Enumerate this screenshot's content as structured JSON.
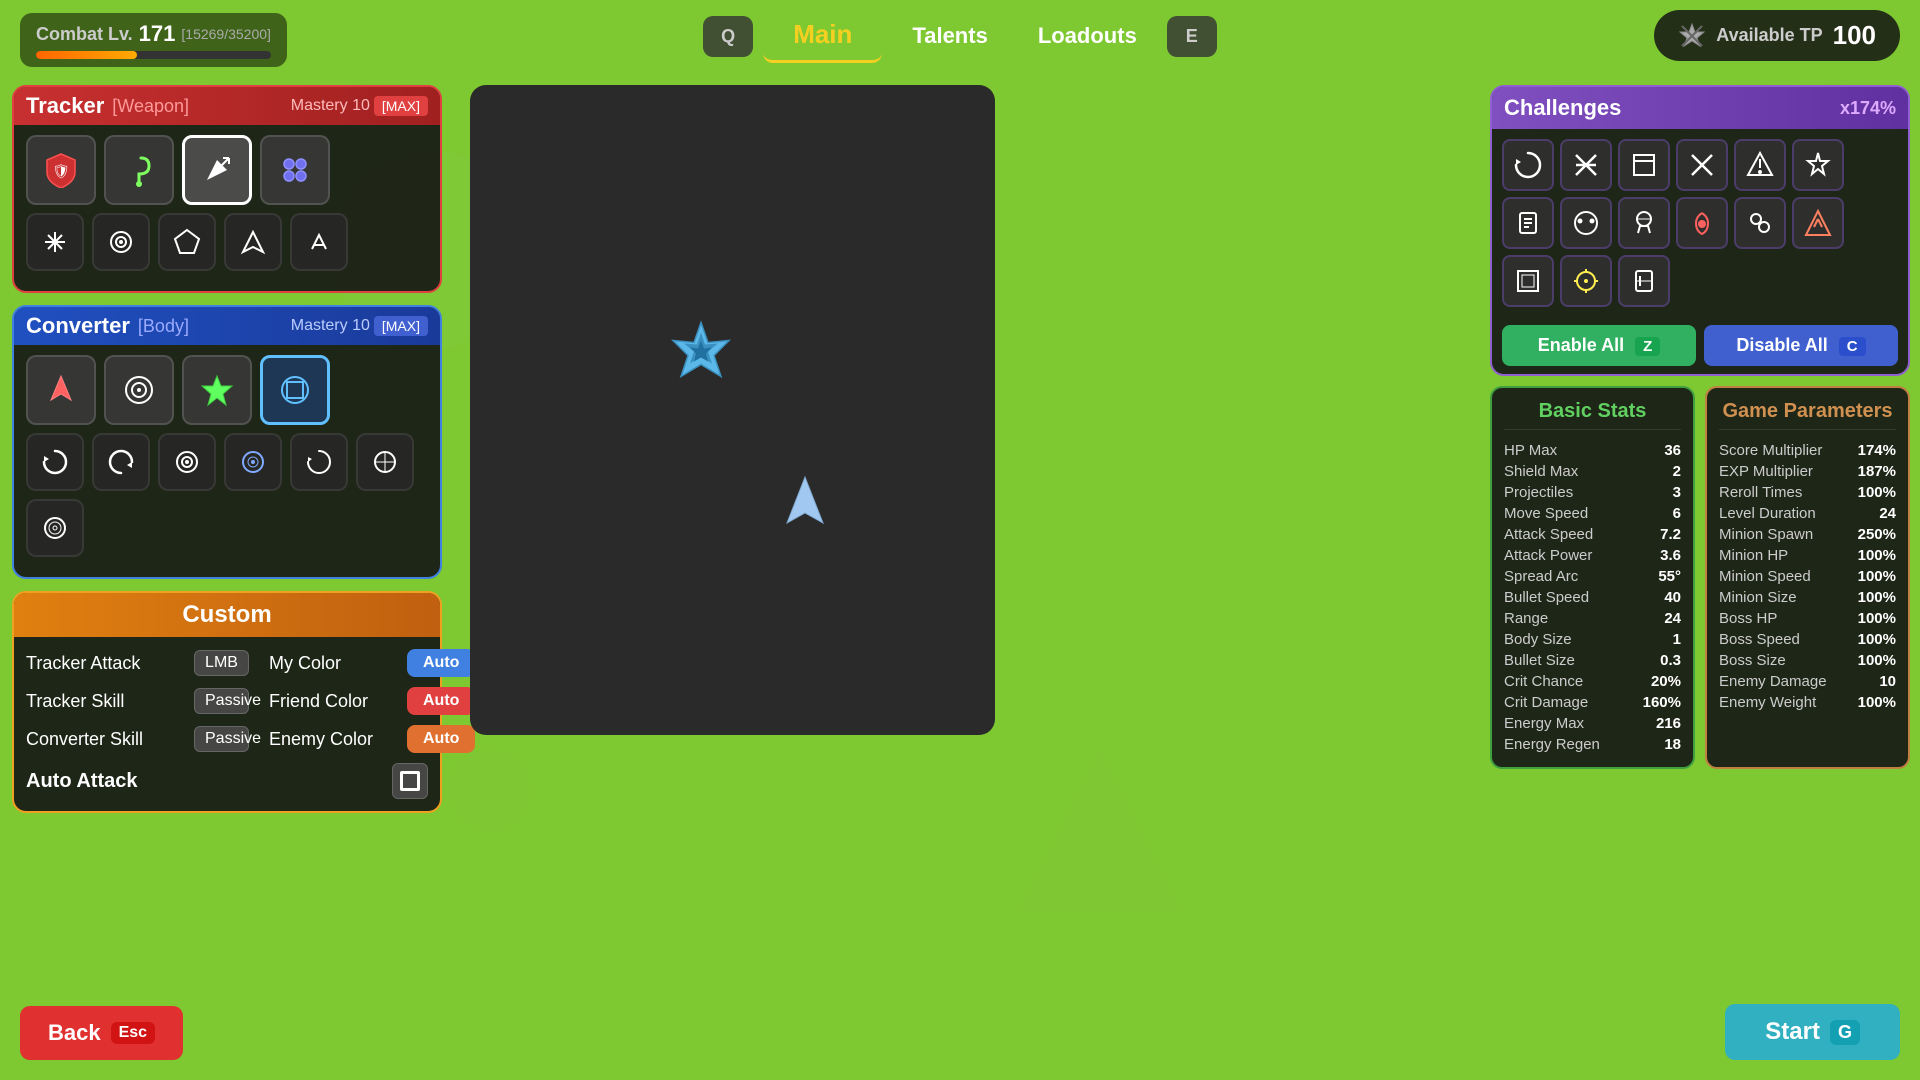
{
  "header": {
    "combat_level_label": "Combat Lv.",
    "combat_level": "171",
    "exp_current": "15269",
    "exp_max": "35200",
    "exp_display": "[15269/35200]",
    "available_tp_label": "Available TP",
    "available_tp": "100"
  },
  "nav": {
    "q_key": "Q",
    "main_tab": "Main",
    "talents_tab": "Talents",
    "loadouts_tab": "Loadouts",
    "e_key": "E"
  },
  "tracker_panel": {
    "title": "Tracker",
    "subtitle": "[Weapon]",
    "mastery_label": "Mastery 10",
    "max_label": "[MAX]"
  },
  "converter_panel": {
    "title": "Converter",
    "subtitle": "[Body]",
    "mastery_label": "Mastery 10",
    "max_label": "[MAX]"
  },
  "custom_panel": {
    "title": "Custom",
    "tracker_attack_label": "Tracker Attack",
    "tracker_attack_key": "LMB",
    "my_color_label": "My Color",
    "my_color_btn": "Auto",
    "tracker_skill_label": "Tracker Skill",
    "tracker_skill_key": "Passive",
    "friend_color_label": "Friend Color",
    "friend_color_btn": "Auto",
    "converter_skill_label": "Converter Skill",
    "converter_skill_key": "Passive",
    "enemy_color_label": "Enemy Color",
    "enemy_color_btn": "Auto",
    "auto_attack_label": "Auto Attack"
  },
  "challenges": {
    "title": "Challenges",
    "multiplier": "x174%",
    "enable_btn": "Enable All",
    "enable_key": "Z",
    "disable_btn": "Disable All",
    "disable_key": "C"
  },
  "basic_stats": {
    "title": "Basic Stats",
    "stats": [
      {
        "label": "HP Max",
        "value": "36"
      },
      {
        "label": "Shield Max",
        "value": "2"
      },
      {
        "label": "Projectiles",
        "value": "3"
      },
      {
        "label": "Move Speed",
        "value": "6"
      },
      {
        "label": "Attack Speed",
        "value": "7.2"
      },
      {
        "label": "Attack Power",
        "value": "3.6"
      },
      {
        "label": "Spread Arc",
        "value": "55°"
      },
      {
        "label": "Bullet Speed",
        "value": "40"
      },
      {
        "label": "Range",
        "value": "24"
      },
      {
        "label": "Body Size",
        "value": "1"
      },
      {
        "label": "Bullet Size",
        "value": "0.3"
      },
      {
        "label": "Crit Chance",
        "value": "20%"
      },
      {
        "label": "Crit Damage",
        "value": "160%"
      },
      {
        "label": "Energy Max",
        "value": "216"
      },
      {
        "label": "Energy Regen",
        "value": "18"
      }
    ]
  },
  "game_params": {
    "title": "Game Parameters",
    "params": [
      {
        "label": "Score Multiplier",
        "value": "174%"
      },
      {
        "label": "EXP Multiplier",
        "value": "187%"
      },
      {
        "label": "Reroll Times",
        "value": "100%"
      },
      {
        "label": "Level Duration",
        "value": "24"
      },
      {
        "label": "Minion Spawn",
        "value": "250%"
      },
      {
        "label": "Minion HP",
        "value": "100%"
      },
      {
        "label": "Minion Speed",
        "value": "100%"
      },
      {
        "label": "Minion Size",
        "value": "100%"
      },
      {
        "label": "Boss HP",
        "value": "100%"
      },
      {
        "label": "Boss Speed",
        "value": "100%"
      },
      {
        "label": "Boss Size",
        "value": "100%"
      },
      {
        "label": "Enemy Damage",
        "value": "10"
      },
      {
        "label": "Enemy Weight",
        "value": "100%"
      }
    ]
  },
  "buttons": {
    "back_label": "Back",
    "back_key": "Esc",
    "start_label": "Start",
    "start_key": "G"
  },
  "icons": {
    "tracker": [
      "🛡",
      "🪝",
      "✈",
      "⚙"
    ],
    "tracker_row2": [
      "⚡",
      "🎯",
      "◆",
      "↩",
      "↘"
    ],
    "converter": [
      "🦅",
      "🎯",
      "⭐",
      "🔲"
    ],
    "converter_row2": [
      "↻",
      "↺",
      "🎯",
      "🎯",
      "↻",
      "⊙",
      "⊕"
    ],
    "challenges_row1": [
      "↺",
      "✂",
      "📋",
      "✖",
      "⬆",
      "📍",
      "📦",
      "👁"
    ],
    "challenges_row2": [
      "☠",
      "❤",
      "👤",
      "💥",
      "◇",
      "☀",
      "⏳"
    ]
  }
}
